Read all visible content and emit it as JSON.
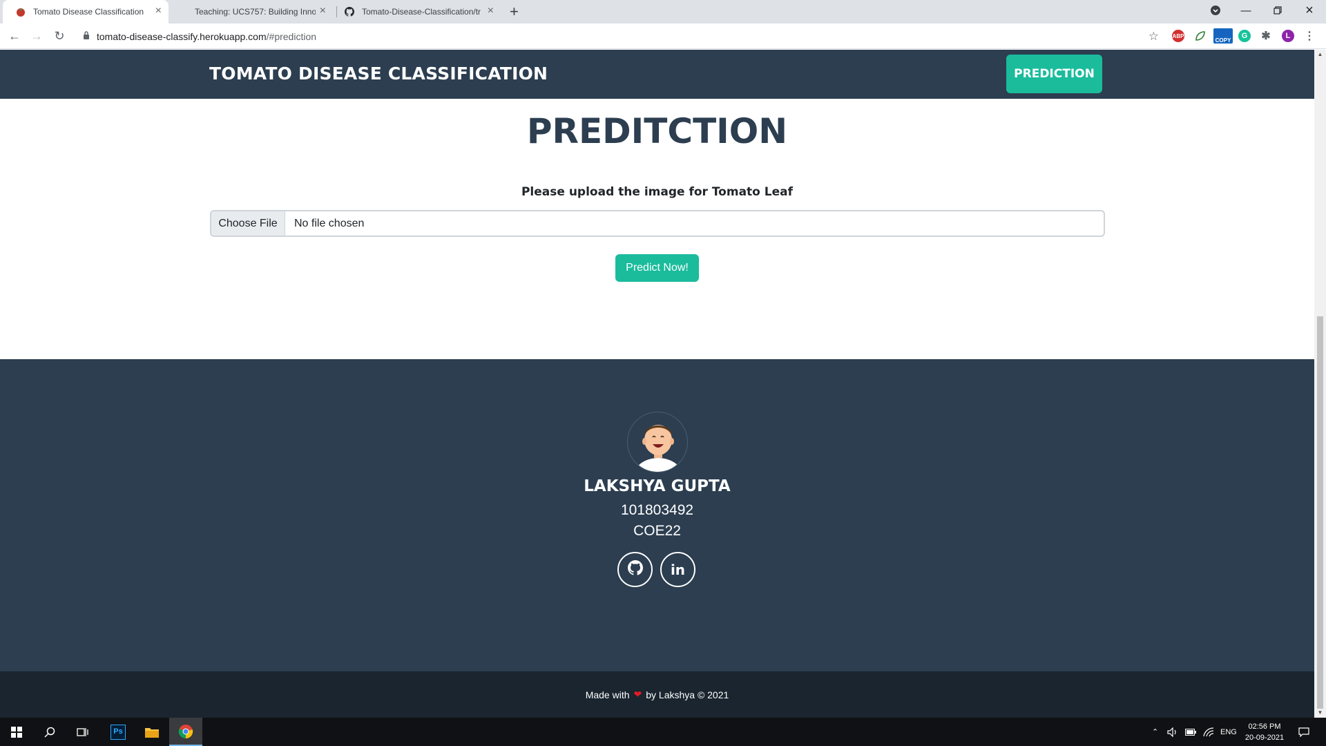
{
  "browser": {
    "tabs": [
      {
        "title": "Tomato Disease Classification",
        "active": true
      },
      {
        "title": "Teaching: UCS757: Building Innov",
        "active": false
      },
      {
        "title": "Tomato-Disease-Classification/tr",
        "active": false
      }
    ],
    "url_host": "tomato-disease-classify.herokuapp.com",
    "url_path": "/#prediction",
    "extensions": [
      "abp-icon",
      "leaf-ext-icon",
      "copy-ext-icon",
      "grammarly-icon",
      "puzzle-icon"
    ],
    "profile_initial": "L",
    "ext_labels": {
      "abp": "ABP",
      "copy": "COPY"
    }
  },
  "navbar": {
    "brand": "TOMATO DISEASE CLASSIFICATION",
    "prediction_link": "PREDICTION"
  },
  "prediction": {
    "title": "PREDITCTION",
    "upload_label": "Please upload the image for Tomato Leaf",
    "file_button": "Choose File",
    "file_status": "No file chosen",
    "predict_button": "Predict Now!"
  },
  "footer": {
    "name": "LAKSHYA GUPTA",
    "roll_number": "101803492",
    "class": "COE22",
    "social": [
      "github-icon",
      "linkedin-icon"
    ],
    "linkedin_text": "in"
  },
  "copyright": {
    "made_with": "Made with",
    "by_text": "by Lakshya © 2021"
  },
  "taskbar": {
    "language": "ENG",
    "time": "02:56 PM",
    "date": "20-09-2021",
    "ps_label": "Ps"
  },
  "colors": {
    "navbar_bg": "#2c3e50",
    "accent": "#1abc9c",
    "copyright_bg": "#1a252f",
    "heart": "#e31b23"
  }
}
